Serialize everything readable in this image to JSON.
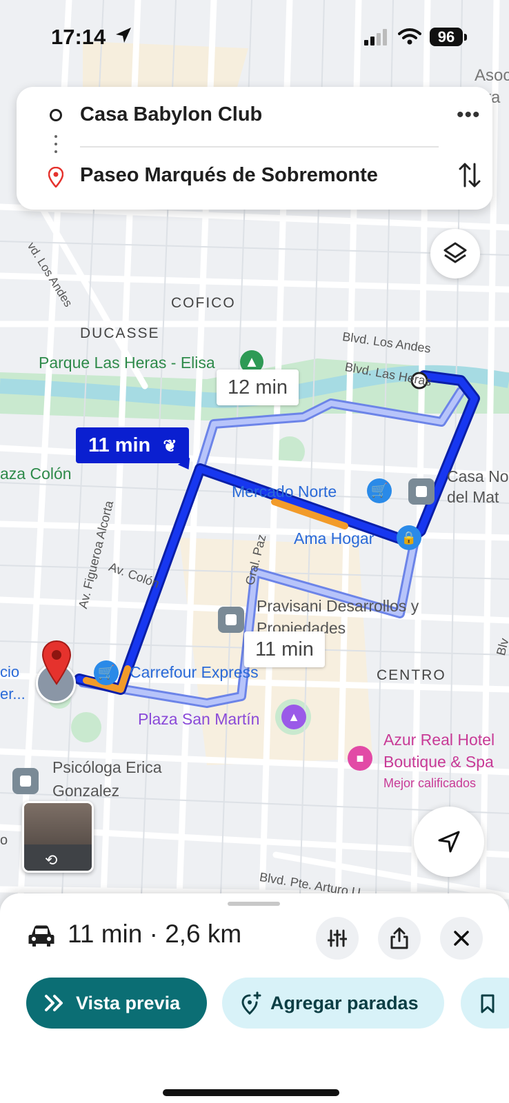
{
  "status_bar": {
    "time": "17:14",
    "battery": "96"
  },
  "route": {
    "origin": "Casa Babylon Club",
    "destination": "Paseo Marqués de Sobremonte"
  },
  "map": {
    "labels": {
      "asoc": "Asoc",
      "va": "va",
      "los_andes_diag": "vd. Los Andes",
      "cofico": "COFICO",
      "ducasse": "DUCASSE",
      "parque": "Parque Las Heras - Elisa",
      "blvd_andes": "Blvd. Los Andes",
      "blvd_heras": "Blvd. Las Heras",
      "plaza_colon": "aza Colón",
      "casa_no": "Casa No",
      "del_mat": "del Mat",
      "mercado": "Mercado Norte",
      "ama_hogar": "Ama Hogar",
      "figueroa": "Av. Figueroa Alcorta",
      "av_colon": "Av. Colón",
      "gral_paz": "Gral. Paz",
      "pravisani_1": "Pravisani Desarrollos y",
      "pravisani_2": "Propiedades",
      "carrefour": "Carrefour Express",
      "centro": "CENTRO",
      "plaza_sm": "Plaza San Martín",
      "cio": "cio",
      "er": "er...",
      "azur_1": "Azur Real Hotel",
      "azur_2": "Boutique & Spa",
      "azur_3": "Mejor calificados",
      "psico_1": "Psicóloga Erica",
      "psico_2": "Gonzalez",
      "blvd_arturo": "Blvd. Pte. Arturo U",
      "edge_o": "o",
      "edge_blv": "Blv"
    },
    "route_bubbles": {
      "primary": "11 min",
      "alt1": "12 min",
      "alt2": "11 min"
    },
    "colors": {
      "route_primary": "#0a24d6",
      "route_alt": "#9fb0f5",
      "traffic": "#f29b2a",
      "park": "#c9e9cf",
      "water": "#a6dbe3"
    }
  },
  "sheet": {
    "summary": "11 min · 2,6 km",
    "preview_label": "Vista previa",
    "add_stops_label": "Agregar paradas"
  },
  "icons": [
    "location-arrow-icon",
    "signal-icon",
    "wifi-icon",
    "more-icon",
    "swap-icon",
    "layers-icon",
    "locate-icon",
    "car-icon",
    "sliders-icon",
    "share-icon",
    "close-icon",
    "chevrons-icon",
    "add-stop-icon",
    "bookmark-icon",
    "leaf-icon"
  ]
}
